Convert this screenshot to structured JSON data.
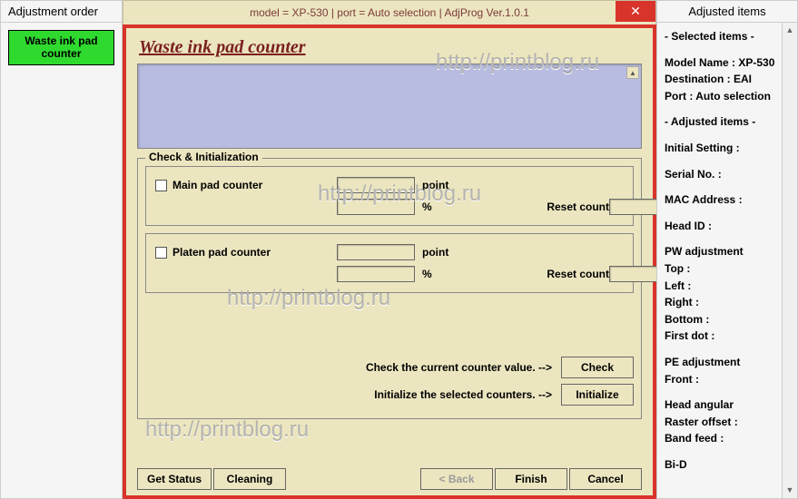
{
  "left": {
    "header": "Adjustment order",
    "button": "Waste ink pad counter"
  },
  "dialog": {
    "title": "model = XP-530 | port = Auto selection | AdjProg Ver.1.0.1",
    "page_title": "Waste ink pad counter",
    "fieldset_legend": "Check & Initialization",
    "main_pad": {
      "label": "Main pad counter",
      "point_label": "point",
      "percent_label": "%",
      "reset_label": "Reset count"
    },
    "platen_pad": {
      "label": "Platen pad counter",
      "point_label": "point",
      "percent_label": "%",
      "reset_label": "Reset count"
    },
    "check_hint": "Check the current counter value. -->",
    "check_btn": "Check",
    "init_hint": "Initialize the selected counters. -->",
    "init_btn": "Initialize",
    "get_status_btn": "Get Status",
    "cleaning_btn": "Cleaning",
    "back_btn": "< Back",
    "finish_btn": "Finish",
    "cancel_btn": "Cancel"
  },
  "right": {
    "header": "Adjusted items",
    "lines": {
      "selected_hdr": "- Selected items -",
      "model": "Model Name : XP-530",
      "dest": "Destination : EAI",
      "port": "Port : Auto selection",
      "adjusted_hdr": "- Adjusted items -",
      "initial": "Initial Setting :",
      "serial": "Serial No. :",
      "mac": "MAC Address :",
      "head": "Head ID :",
      "pw": "PW adjustment",
      "top": "Top :",
      "left": "Left :",
      "right_l": "Right :",
      "bottom": "Bottom :",
      "firstdot": "First dot :",
      "pe": "PE adjustment",
      "front": "Front :",
      "angular": "Head angular",
      "raster": " Raster offset :",
      "band": " Band feed :",
      "bid": "Bi-D"
    }
  },
  "watermark": "http://printblog.ru"
}
